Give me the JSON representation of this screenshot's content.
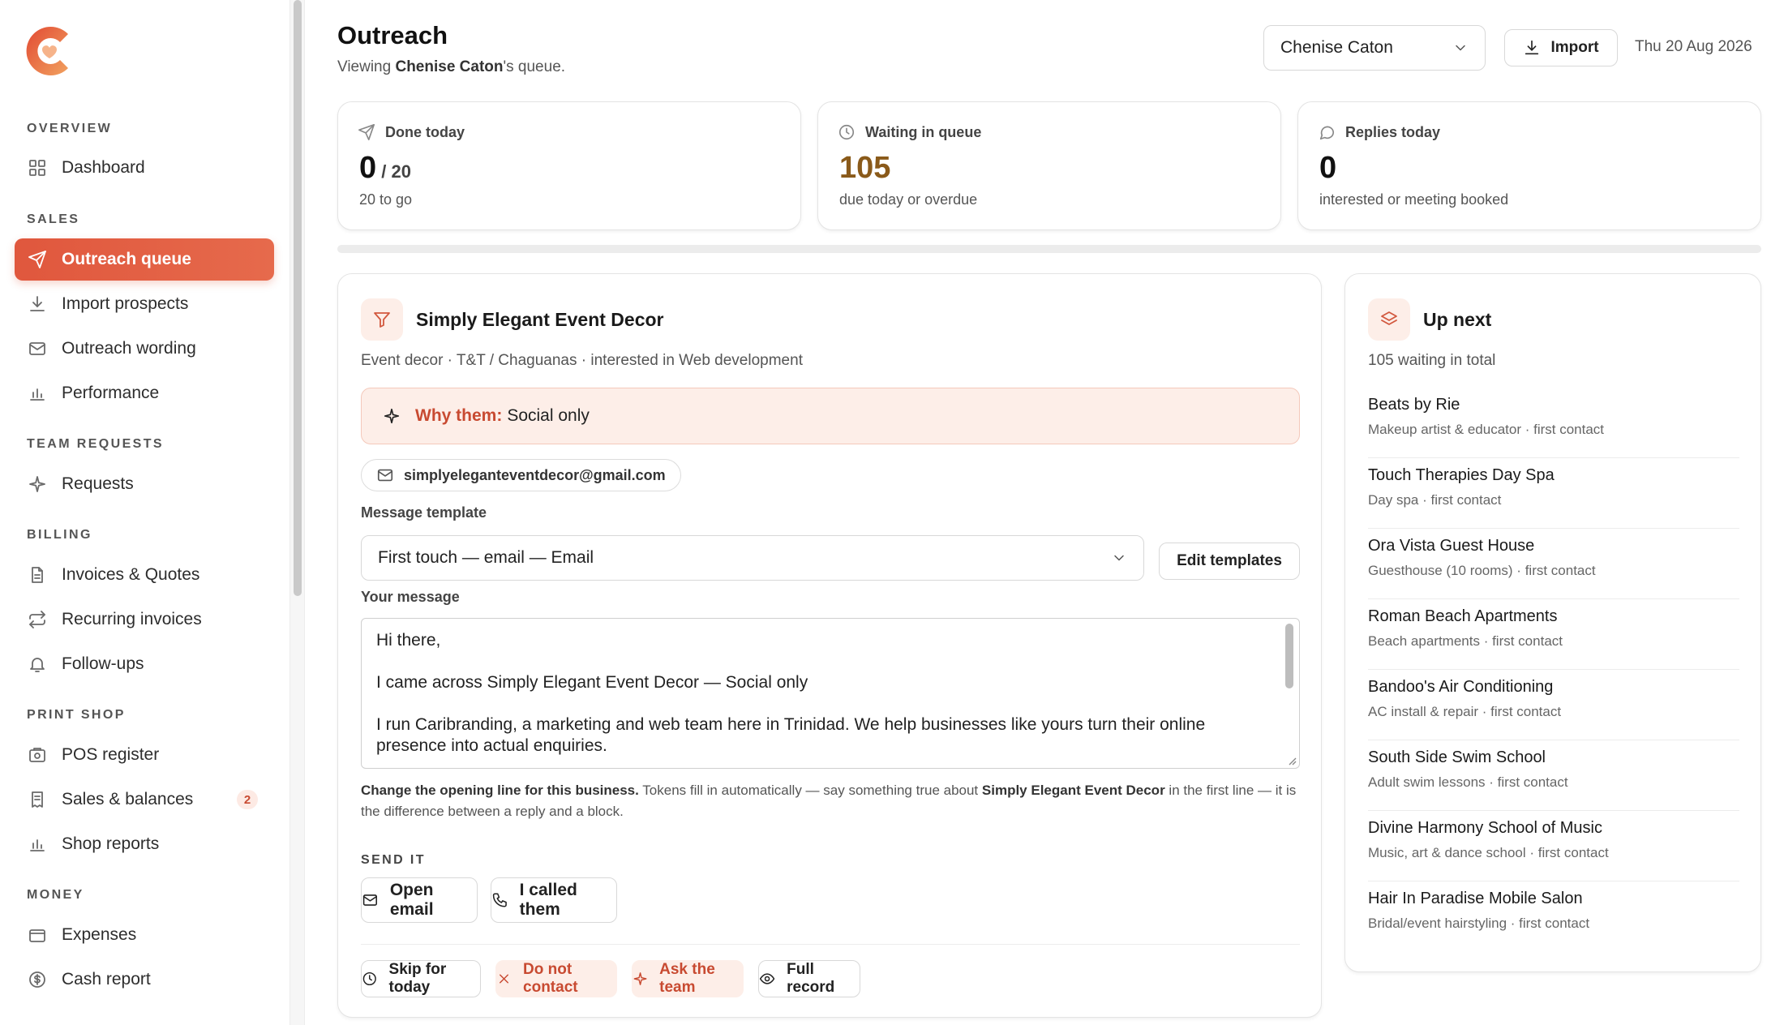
{
  "sidebar": {
    "sections": [
      {
        "title": "OVERVIEW",
        "items": [
          {
            "label": "Dashboard",
            "icon": "grid-icon"
          }
        ]
      },
      {
        "title": "SALES",
        "items": [
          {
            "label": "Outreach queue",
            "icon": "send-icon",
            "active": true
          },
          {
            "label": "Import prospects",
            "icon": "download-icon"
          },
          {
            "label": "Outreach wording",
            "icon": "mail-icon"
          },
          {
            "label": "Performance",
            "icon": "bar-chart-icon"
          }
        ]
      },
      {
        "title": "TEAM REQUESTS",
        "items": [
          {
            "label": "Requests",
            "icon": "sparkle-icon"
          }
        ]
      },
      {
        "title": "BILLING",
        "items": [
          {
            "label": "Invoices & Quotes",
            "icon": "file-icon"
          },
          {
            "label": "Recurring invoices",
            "icon": "repeat-icon"
          },
          {
            "label": "Follow-ups",
            "icon": "bell-icon"
          }
        ]
      },
      {
        "title": "PRINT SHOP",
        "items": [
          {
            "label": "POS register",
            "icon": "register-icon"
          },
          {
            "label": "Sales & balances",
            "icon": "receipt-icon",
            "badge": "2"
          },
          {
            "label": "Shop reports",
            "icon": "bar-chart-icon"
          }
        ]
      },
      {
        "title": "MONEY",
        "items": [
          {
            "label": "Expenses",
            "icon": "wallet-icon"
          },
          {
            "label": "Cash report",
            "icon": "dollar-icon"
          }
        ]
      }
    ]
  },
  "header": {
    "title": "Outreach",
    "subtitle_prefix": "Viewing ",
    "subtitle_name": "Chenise Caton",
    "subtitle_suffix": "'s queue.",
    "user_select": "Chenise Caton",
    "import_label": "Import",
    "date": "Thu 20 Aug 2026"
  },
  "stats": {
    "done": {
      "label": "Done today",
      "value": "0",
      "goal": " / 20",
      "note": "20 to go"
    },
    "waiting": {
      "label": "Waiting in queue",
      "value": "105",
      "note": "due today or overdue"
    },
    "replies": {
      "label": "Replies today",
      "value": "0",
      "note": "interested or meeting booked"
    }
  },
  "progress": 0,
  "prospect": {
    "name": "Simply Elegant Event Decor",
    "meta": "Event decor · T&T / Chaguanas · interested in Web development",
    "why_label": "Why them:",
    "why_value": "Social only",
    "email": "simplyeleganteventdecor@gmail.com",
    "template_label": "Message template",
    "template_value": "First touch — email — Email",
    "edit_templates": "Edit templates",
    "message_label": "Your message",
    "message_lines": [
      "Hi there,",
      "I came across Simply Elegant Event Decor — Social only",
      "I run Caribranding, a marketing and web team here in Trinidad. We help businesses like yours turn their online presence into actual enquiries."
    ],
    "hint_bold1": "Change the opening line for this business.",
    "hint_text1": " Tokens fill in automatically — say something true about ",
    "hint_bold2": "Simply Elegant Event Decor",
    "hint_text2": " in the first line — it is the difference between a reply and a block.",
    "send_label": "SEND IT",
    "open_email": "Open email",
    "called": "I called them",
    "skip": "Skip for today",
    "do_not_contact": "Do not contact",
    "ask_team": "Ask the team",
    "full_record": "Full record"
  },
  "up_next": {
    "title": "Up next",
    "subtitle": "105 waiting in total",
    "items": [
      {
        "name": "Beats by Rie",
        "sub": "Makeup artist & educator · first contact"
      },
      {
        "name": "Touch Therapies Day Spa",
        "sub": "Day spa · first contact"
      },
      {
        "name": "Ora Vista Guest House",
        "sub": "Guesthouse (10 rooms) · first contact"
      },
      {
        "name": "Roman Beach Apartments",
        "sub": "Beach apartments · first contact"
      },
      {
        "name": "Bandoo's Air Conditioning",
        "sub": "AC install & repair · first contact"
      },
      {
        "name": "South Side Swim School",
        "sub": "Adult swim lessons · first contact"
      },
      {
        "name": "Divine Harmony School of Music",
        "sub": "Music, art & dance school · first contact"
      },
      {
        "name": "Hair In Paradise Mobile Salon",
        "sub": "Bridal/event hairstyling · first contact"
      }
    ]
  },
  "colors": {
    "accent": "#e0573d",
    "accent_soft": "#fdeee8",
    "waiting": "#8a5a1a"
  }
}
